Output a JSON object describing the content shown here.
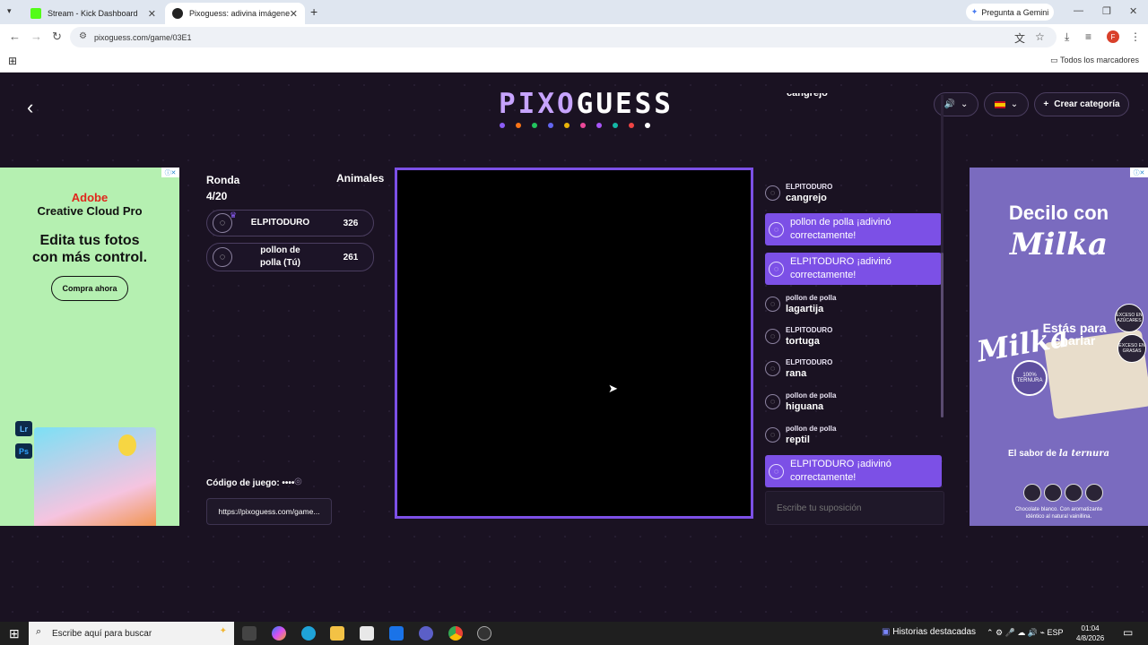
{
  "browser": {
    "tabs": [
      {
        "title": "Stream - Kick Dashboard",
        "favicon_color": "#53fc18"
      },
      {
        "title": "Pixoguess: adivina imágenes p...",
        "favicon_color": "#222222"
      }
    ],
    "gemini_label": "Pregunta a Gemini",
    "url": "pixoguess.com/game/03E1",
    "bookmarks_label": "Todos los marcadores",
    "profile_initial": "F"
  },
  "header": {
    "logo_pixo": "PIXO",
    "logo_guess": "GUESS",
    "logo_dot_colors": [
      "#8b5cf6",
      "#f97316",
      "#22c55e",
      "#6366f1",
      "#eab308",
      "#ec4899",
      "#a855f7",
      "#14b8a6",
      "#ef4444",
      "#ffffff"
    ],
    "create_label": "Crear categoría"
  },
  "ads": {
    "left": {
      "brand_line1": "Adobe",
      "brand_line2": "Creative Cloud Pro",
      "headline_line1": "Edita tus fotos",
      "headline_line2": "con más control.",
      "cta": "Compra ahora",
      "app1": "Lr",
      "app2": "Ps"
    },
    "right": {
      "title_line1": "Decilo con",
      "title_line2": "Milka",
      "brand_mark": "Milka",
      "slogan_line1": "Estás para",
      "slogan_line2": "charlar",
      "seal": "100% TERNURA",
      "badge1": "EXCESO EN AZÚCARES",
      "badge2": "EXCESO EN GRASAS",
      "tagline_prefix": "El sabor de",
      "tagline_emph": "la ternura",
      "footnote_line1": "Chocolate blanco. Con aromatizante",
      "footnote_line2": "idéntico al natural vainillina."
    }
  },
  "game": {
    "round_label": "Ronda",
    "round_value": "4/20",
    "category": "Animales",
    "players": [
      {
        "name": "ELPITODURO",
        "score": "326"
      },
      {
        "name_line1": "pollon de",
        "name_line2": "polla (Tú)",
        "score": "261"
      }
    ],
    "code_label": "Código de juego: ••••",
    "share_link": "https://pixoguess.com/game..."
  },
  "chat": {
    "top_partial": "cangrejo",
    "messages": [
      {
        "type": "guess",
        "user": "ELPITODURO",
        "text": "cangrejo"
      },
      {
        "type": "system",
        "line1": "pollon de polla ¡adivinó",
        "line2": "correctamente!"
      },
      {
        "type": "system",
        "line1": "ELPITODURO ¡adivinó",
        "line2": "correctamente!"
      },
      {
        "type": "guess",
        "user": "pollon de polla",
        "text": "lagartija"
      },
      {
        "type": "guess",
        "user": "ELPITODURO",
        "text": "tortuga"
      },
      {
        "type": "guess",
        "user": "ELPITODURO",
        "text": "rana"
      },
      {
        "type": "guess",
        "user": "pollon de polla",
        "text": "higuana"
      },
      {
        "type": "guess",
        "user": "pollon de polla",
        "text": "reptil"
      },
      {
        "type": "system",
        "line1": "ELPITODURO ¡adivinó",
        "line2": "correctamente!"
      }
    ],
    "input_placeholder": "Escribe tu suposición"
  },
  "taskbar": {
    "search_placeholder": "Escribe aquí para buscar",
    "news_label": "Historias destacadas",
    "lang": "ESP",
    "time": "01:04",
    "date": "4/8/2026"
  }
}
